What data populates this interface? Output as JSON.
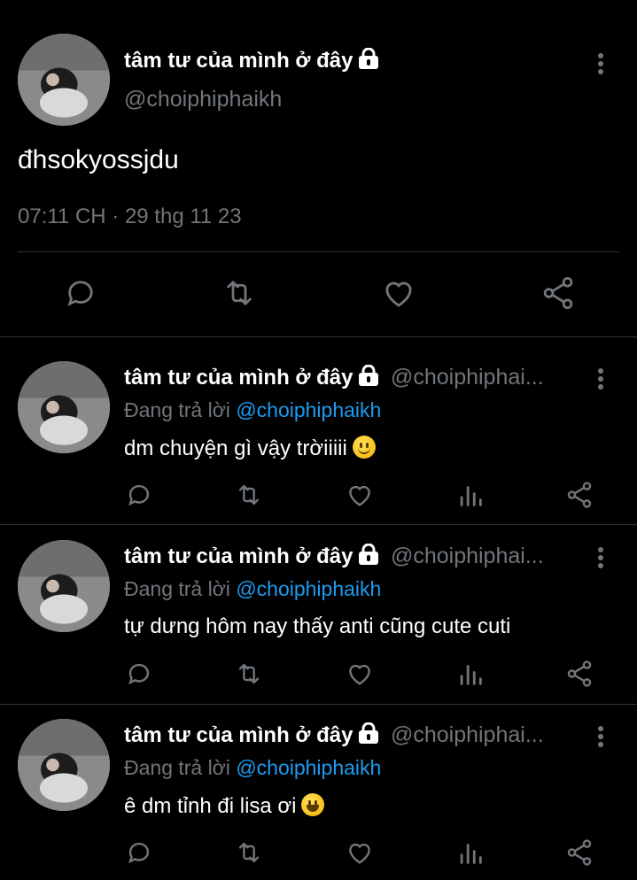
{
  "main_tweet": {
    "author_name": "tâm tư của mình ở đây",
    "handle": "@choiphiphaikh",
    "text": "đhsokyossjdu",
    "timestamp": "07:11 CH · 29 thg 11 23"
  },
  "replies": [
    {
      "author_name": "tâm tư của mình ở đây",
      "handle": "@choiphiphai...",
      "replying_prefix": "Đang trả lời",
      "replying_to": "@choiphiphaikh",
      "text": "dm chuyện gì vậy trờiiiii",
      "emoji": "slight-smile"
    },
    {
      "author_name": "tâm tư của mình ở đây",
      "handle": "@choiphiphai...",
      "replying_prefix": "Đang trả lời",
      "replying_to": "@choiphiphaikh",
      "text": "tự dưng hôm nay thấy anti cũng cute cuti",
      "emoji": ""
    },
    {
      "author_name": "tâm tư của mình ở đây",
      "handle": "@choiphiphai...",
      "replying_prefix": "Đang trả lời",
      "replying_to": "@choiphiphaikh",
      "text": "ê dm tỉnh đi lisa ơi",
      "emoji": "grin"
    }
  ],
  "icons": [
    "lock-icon",
    "more-vertical-icon",
    "reply-icon",
    "retweet-icon",
    "like-icon",
    "views-icon",
    "share-icon"
  ],
  "colors": {
    "background": "#000000",
    "secondary_text": "#71767b",
    "mention": "#1d9bf0",
    "divider": "#2f3336"
  }
}
